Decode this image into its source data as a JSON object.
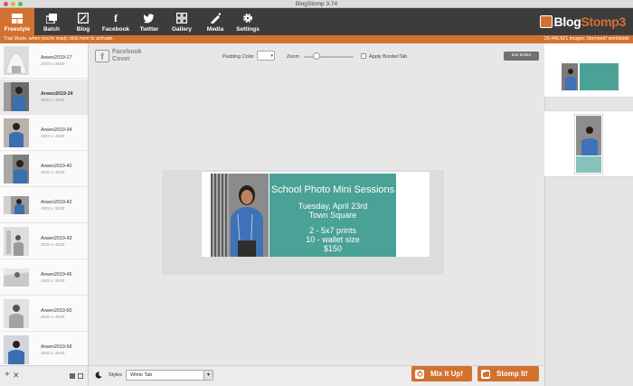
{
  "window": {
    "title": "BlogStomp 3.74"
  },
  "toolbar": {
    "items": [
      {
        "label": "Freestyle",
        "icon": "freestyle-icon",
        "active": true
      },
      {
        "label": "Batch",
        "icon": "batch-icon"
      },
      {
        "label": "Blog",
        "icon": "blog-icon"
      },
      {
        "label": "Facebook",
        "icon": "facebook-icon"
      },
      {
        "label": "Twitter",
        "icon": "twitter-icon"
      },
      {
        "label": "Gallery",
        "icon": "gallery-icon"
      },
      {
        "label": "Media",
        "icon": "media-icon"
      },
      {
        "label": "Settings",
        "icon": "settings-icon"
      }
    ],
    "logo_prefix": "Blog",
    "logo_suffix": "Stomp3"
  },
  "trial": {
    "message": "Trial Mode, when you're ready click here to activate.",
    "stomped": "29,440,621 images Stomped! worldwide"
  },
  "sidebar": {
    "images": [
      {
        "name": "Arwen2019-17",
        "dims": "3000 x 4500"
      },
      {
        "name": "Arwen2019-24",
        "dims": "3000 x 4500",
        "selected": true
      },
      {
        "name": "Arwen2019-34",
        "dims": "3000 x 4500"
      },
      {
        "name": "Arwen2019-40",
        "dims": "3000 x 4500"
      },
      {
        "name": "Arwen2019-42",
        "dims": "4500 x 3000"
      },
      {
        "name": "Arwen2019-43",
        "dims": "3000 x 4500"
      },
      {
        "name": "Arwen2019-45",
        "dims": "4500 x 3000"
      },
      {
        "name": "Arwen2019-50",
        "dims": "3000 x 4500"
      },
      {
        "name": "Arwen2019-58",
        "dims": "3000 x 4500"
      }
    ]
  },
  "controls": {
    "facebook_cover": "Facebook Cover",
    "padding_color_label": "Padding Color",
    "zoom_label": "Zoom",
    "zoom_level": 0.25,
    "apply_border_label": "Apply Border/Tab",
    "exit_editor_label": "Exit Editor"
  },
  "banner": {
    "title": "School Photo Mini Sessions",
    "line1": "Tuesday, April 23rd",
    "line2": "Town Square",
    "line3": "2 - 5x7 prints",
    "line4": "10 - wallet size",
    "line5": "$150",
    "teal_color": "#4aa195"
  },
  "bottom": {
    "styles_label": "Styles",
    "styles_value": "White Tab",
    "mix_label": "Mix It Up!",
    "stomp_label": "Stomp It!"
  },
  "colors": {
    "accent": "#d3712e",
    "toolbar_bg": "#3c3c3c"
  }
}
